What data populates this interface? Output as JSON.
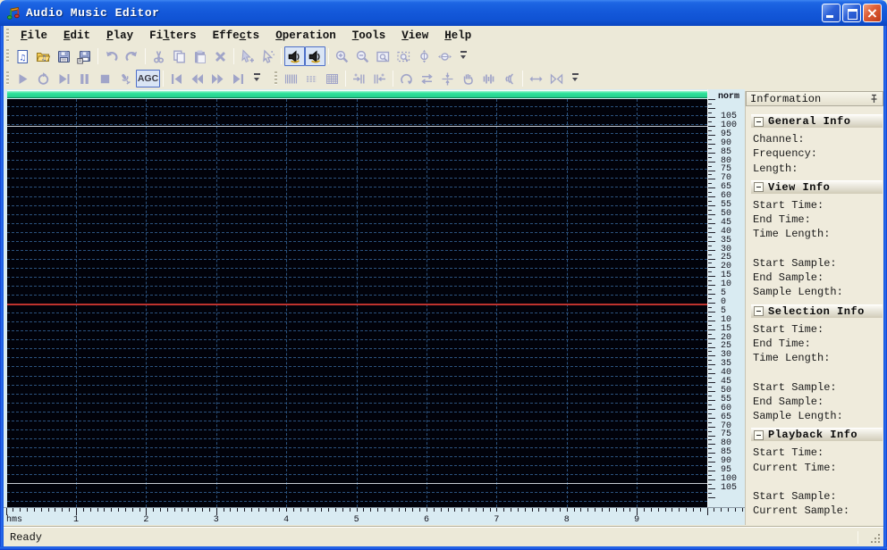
{
  "window": {
    "title": "Audio Music Editor"
  },
  "menu_bar": {
    "items": [
      {
        "label": "File",
        "accel": "F"
      },
      {
        "label": "Edit",
        "accel": "E"
      },
      {
        "label": "Play",
        "accel": "P"
      },
      {
        "label": "Filters",
        "accel": "l"
      },
      {
        "label": "Effects",
        "accel": "c"
      },
      {
        "label": "Operation",
        "accel": "O"
      },
      {
        "label": "Tools",
        "accel": "T"
      },
      {
        "label": "View",
        "accel": "V"
      },
      {
        "label": "Help",
        "accel": "H"
      }
    ]
  },
  "toolbar_standard": {
    "items": [
      {
        "icon": "new-audio-file-icon",
        "enabled": true
      },
      {
        "icon": "open-file-icon",
        "enabled": true
      },
      {
        "icon": "save-icon",
        "enabled": true
      },
      {
        "icon": "save-as-icon",
        "enabled": true
      },
      {
        "sep": true
      },
      {
        "icon": "undo-icon",
        "enabled": false
      },
      {
        "icon": "redo-icon",
        "enabled": false
      },
      {
        "sep": true
      },
      {
        "icon": "cut-icon",
        "enabled": false
      },
      {
        "icon": "copy-icon",
        "enabled": false
      },
      {
        "icon": "paste-icon",
        "enabled": false
      },
      {
        "icon": "delete-icon",
        "enabled": false
      },
      {
        "sep": true
      },
      {
        "icon": "select-add-icon",
        "enabled": false
      },
      {
        "icon": "select-tool-icon",
        "enabled": false
      },
      {
        "sep": true
      },
      {
        "icon": "left-channel-icon",
        "enabled": true,
        "selected": true
      },
      {
        "icon": "right-channel-icon",
        "enabled": true,
        "selected": true
      },
      {
        "sep": true
      },
      {
        "icon": "zoom-in-icon",
        "enabled": false
      },
      {
        "icon": "zoom-out-icon",
        "enabled": false
      },
      {
        "icon": "zoom-window-icon",
        "enabled": false
      },
      {
        "icon": "zoom-selection-icon",
        "enabled": false
      },
      {
        "icon": "zoom-vertical-in-icon",
        "enabled": false
      },
      {
        "icon": "zoom-vertical-out-icon",
        "enabled": false
      }
    ]
  },
  "toolbar_transport": {
    "items": [
      {
        "icon": "play-icon",
        "enabled": false
      },
      {
        "icon": "loop-play-icon",
        "enabled": false
      },
      {
        "icon": "play-all-icon",
        "enabled": false
      },
      {
        "icon": "pause-icon",
        "enabled": false
      },
      {
        "icon": "stop-icon",
        "enabled": false
      },
      {
        "icon": "record-icon",
        "enabled": false
      },
      {
        "type": "text",
        "label": "AGC",
        "name": "agc",
        "enabled": true,
        "selected": true
      },
      {
        "sep": true
      },
      {
        "icon": "go-start-icon",
        "enabled": false
      },
      {
        "icon": "rewind-icon",
        "enabled": false
      },
      {
        "icon": "fast-forward-icon",
        "enabled": false
      },
      {
        "icon": "go-end-icon",
        "enabled": false
      }
    ]
  },
  "toolbar_edit": {
    "items": [
      {
        "icon": "time-ruler-icon",
        "enabled": false
      },
      {
        "icon": "sample-ruler-icon",
        "enabled": false
      },
      {
        "icon": "grid-icon",
        "enabled": false
      },
      {
        "sep": true
      },
      {
        "icon": "snap-left-icon",
        "enabled": false
      },
      {
        "icon": "snap-right-icon",
        "enabled": false
      },
      {
        "sep": true
      },
      {
        "icon": "reverse-icon",
        "enabled": false
      },
      {
        "icon": "swap-channels-icon",
        "enabled": false
      },
      {
        "icon": "center-wave-icon",
        "enabled": false
      },
      {
        "icon": "grab-icon",
        "enabled": false
      },
      {
        "icon": "amplitude-bars-icon",
        "enabled": false
      },
      {
        "icon": "echo-icon",
        "enabled": false
      },
      {
        "sep": true
      },
      {
        "icon": "stretch-icon",
        "enabled": false
      },
      {
        "icon": "shrink-icon",
        "enabled": false
      }
    ]
  },
  "wave_view": {
    "scale_top_label": "norm",
    "scale_labels": [
      105,
      100,
      95,
      90,
      85,
      80,
      75,
      70,
      65,
      60,
      55,
      50,
      45,
      40,
      35,
      30,
      25,
      20,
      15,
      10,
      5,
      0,
      5,
      10,
      15,
      20,
      25,
      30,
      35,
      40,
      45,
      50,
      55,
      60,
      65,
      70,
      75,
      80,
      85,
      90,
      95,
      100,
      105
    ],
    "ruler_unit": "hms",
    "ruler_numbers": [
      1,
      2,
      3,
      4,
      5,
      6,
      7,
      8,
      9
    ],
    "colors": {
      "overview_bar": "#2EE29B",
      "background": "#01020A",
      "grid": "#2B527E",
      "center_line": "#BE332E",
      "norm_line": "#C6CBD2",
      "panel_blue": "#D9EBF2",
      "selected_border": "#4D6FC8"
    }
  },
  "info_panel": {
    "title": "Information",
    "sections": [
      {
        "title": "General Info",
        "groups": [
          [
            "Channel:",
            "Frequency:",
            "Length:"
          ]
        ]
      },
      {
        "title": "View Info",
        "groups": [
          [
            "Start Time:",
            "End Time:",
            "Time Length:"
          ],
          [
            "Start Sample:",
            "End Sample:",
            "Sample Length:"
          ]
        ]
      },
      {
        "title": "Selection Info",
        "groups": [
          [
            "Start Time:",
            "End Time:",
            "Time Length:"
          ],
          [
            "Start Sample:",
            "End Sample:",
            "Sample Length:"
          ]
        ]
      },
      {
        "title": "Playback Info",
        "groups": [
          [
            "Start Time:",
            "Current Time:"
          ],
          [
            "Start Sample:",
            "Current Sample:"
          ]
        ]
      }
    ]
  },
  "status_bar": {
    "text": "Ready"
  }
}
